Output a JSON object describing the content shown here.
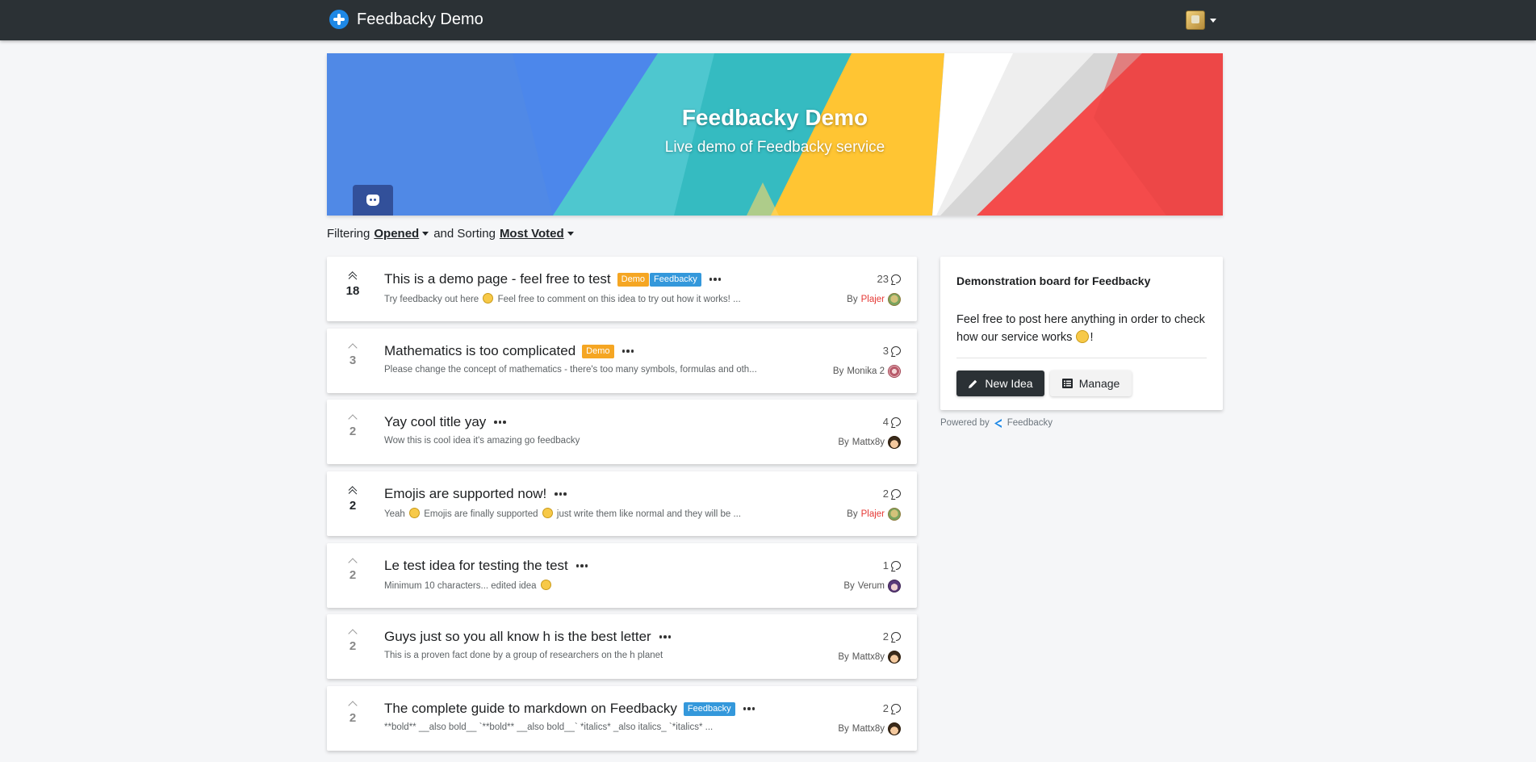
{
  "navbar": {
    "brand": "Feedbacky Demo",
    "brand_icon": "feedbacky-logo-icon",
    "user_avatar": "user-avatar"
  },
  "banner": {
    "title": "Feedbacky Demo",
    "subtitle": "Live demo of Feedbacky service",
    "discord_icon": "discord-icon",
    "colors": [
      "#5089e6",
      "#4ec7cf",
      "#ffc533",
      "#ffffff",
      "#f44b4b"
    ]
  },
  "filter": {
    "filtering_label": "Filtering",
    "filtering_value": "Opened",
    "sorting_label": "and Sorting",
    "sorting_value": "Most Voted"
  },
  "ideas": [
    {
      "votes": "18",
      "voted": true,
      "title": "This is a demo page - feel free to test",
      "tags": [
        "Demo",
        "Feedbacky"
      ],
      "desc_a": "Try feedbacky out here",
      "desc_b": "Feel free to comment on this idea to try out how it works! ...",
      "comments": "23",
      "by": "By",
      "author": "Plajer",
      "author_color": "#e53935"
    },
    {
      "votes": "3",
      "voted": false,
      "title": "Mathematics is too complicated",
      "tags": [
        "Demo"
      ],
      "desc_a": "Please change the concept of mathematics - there's too many symbols, formulas and oth...",
      "desc_b": "",
      "comments": "3",
      "by": "By",
      "author": "Monika 2",
      "author_color": ""
    },
    {
      "votes": "2",
      "voted": false,
      "title": "Yay cool title yay",
      "tags": [],
      "desc_a": "Wow this is cool idea it's amazing go feedbacky",
      "desc_b": "",
      "comments": "4",
      "by": "By",
      "author": "Mattx8y",
      "author_color": ""
    },
    {
      "votes": "2",
      "voted": true,
      "title": "Emojis are supported now!",
      "tags": [],
      "desc_a": "Yeah",
      "desc_b": "Emojis are finally supported",
      "desc_c": "just write them like normal and they will be ...",
      "comments": "2",
      "by": "By",
      "author": "Plajer",
      "author_color": "#e53935"
    },
    {
      "votes": "2",
      "voted": false,
      "title": "Le test idea for testing the test",
      "tags": [],
      "desc_a": "Minimum 10 characters... edited idea",
      "desc_b": "",
      "comments": "1",
      "by": "By",
      "author": "Verum",
      "author_color": ""
    },
    {
      "votes": "2",
      "voted": false,
      "title": "Guys just so you all know h is the best letter",
      "tags": [],
      "desc_a": "This is a proven fact done by a group of researchers on the h planet",
      "desc_b": "",
      "comments": "2",
      "by": "By",
      "author": "Mattx8y",
      "author_color": ""
    },
    {
      "votes": "2",
      "voted": false,
      "title": "The complete guide to markdown on Feedbacky",
      "tags": [
        "Feedbacky"
      ],
      "desc_a": "**bold** __also bold__ `**bold** __also bold__` *italics* _also italics_ `*italics* ...",
      "desc_b": "",
      "comments": "2",
      "by": "By",
      "author": "Mattx8y",
      "author_color": ""
    }
  ],
  "sidebar": {
    "title": "Demonstration board for Feedbacky",
    "body_a": "Feel free to post here anything in order to check how our service works",
    "body_b": "!",
    "new_idea": "New Idea",
    "manage": "Manage"
  },
  "footer": {
    "powered_by": "Powered by",
    "brand": "Feedbacky"
  }
}
